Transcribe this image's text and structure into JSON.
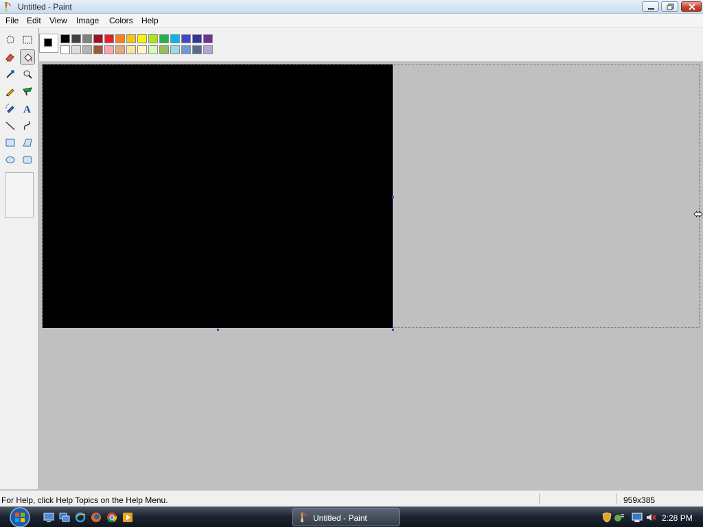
{
  "window": {
    "title": "Untitled - Paint"
  },
  "menu": [
    "File",
    "Edit",
    "View",
    "Image",
    "Colors",
    "Help"
  ],
  "tools": [
    {
      "name": "free-form-select-icon"
    },
    {
      "name": "select-icon"
    },
    {
      "name": "eraser-icon"
    },
    {
      "name": "fill-with-color-icon"
    },
    {
      "name": "pick-color-icon"
    },
    {
      "name": "magnifier-icon"
    },
    {
      "name": "pencil-icon"
    },
    {
      "name": "brush-icon"
    },
    {
      "name": "airbrush-icon"
    },
    {
      "name": "text-icon"
    },
    {
      "name": "line-icon"
    },
    {
      "name": "curve-icon"
    },
    {
      "name": "rectangle-icon"
    },
    {
      "name": "polygon-icon"
    },
    {
      "name": "ellipse-icon"
    },
    {
      "name": "rounded-rectangle-icon"
    }
  ],
  "palette_top": [
    "#000000",
    "#404040",
    "#808080",
    "#a0102a",
    "#e81c24",
    "#ff7f1f",
    "#ffc20e",
    "#fff200",
    "#a8e61d",
    "#22b14c",
    "#00b7ef",
    "#3f48cc",
    "#2f3699",
    "#6f3198"
  ],
  "palette_bottom": [
    "#ffffff",
    "#dcdcdc",
    "#b4b4b4",
    "#9c5a3c",
    "#ffa3b1",
    "#e5aa7a",
    "#f5e49c",
    "#fff9bd",
    "#d3f9bc",
    "#9dbb61",
    "#99d9ea",
    "#709ad1",
    "#546d8e",
    "#b5a5d5"
  ],
  "foreground_color": "#000000",
  "background_color": "#ffffff",
  "status": {
    "help_text": "For Help, click Help Topics on the Help Menu.",
    "canvas_size": "959x385"
  },
  "taskbar": {
    "active_window_label": "Untitled - Paint",
    "clock": "2:28 PM"
  }
}
